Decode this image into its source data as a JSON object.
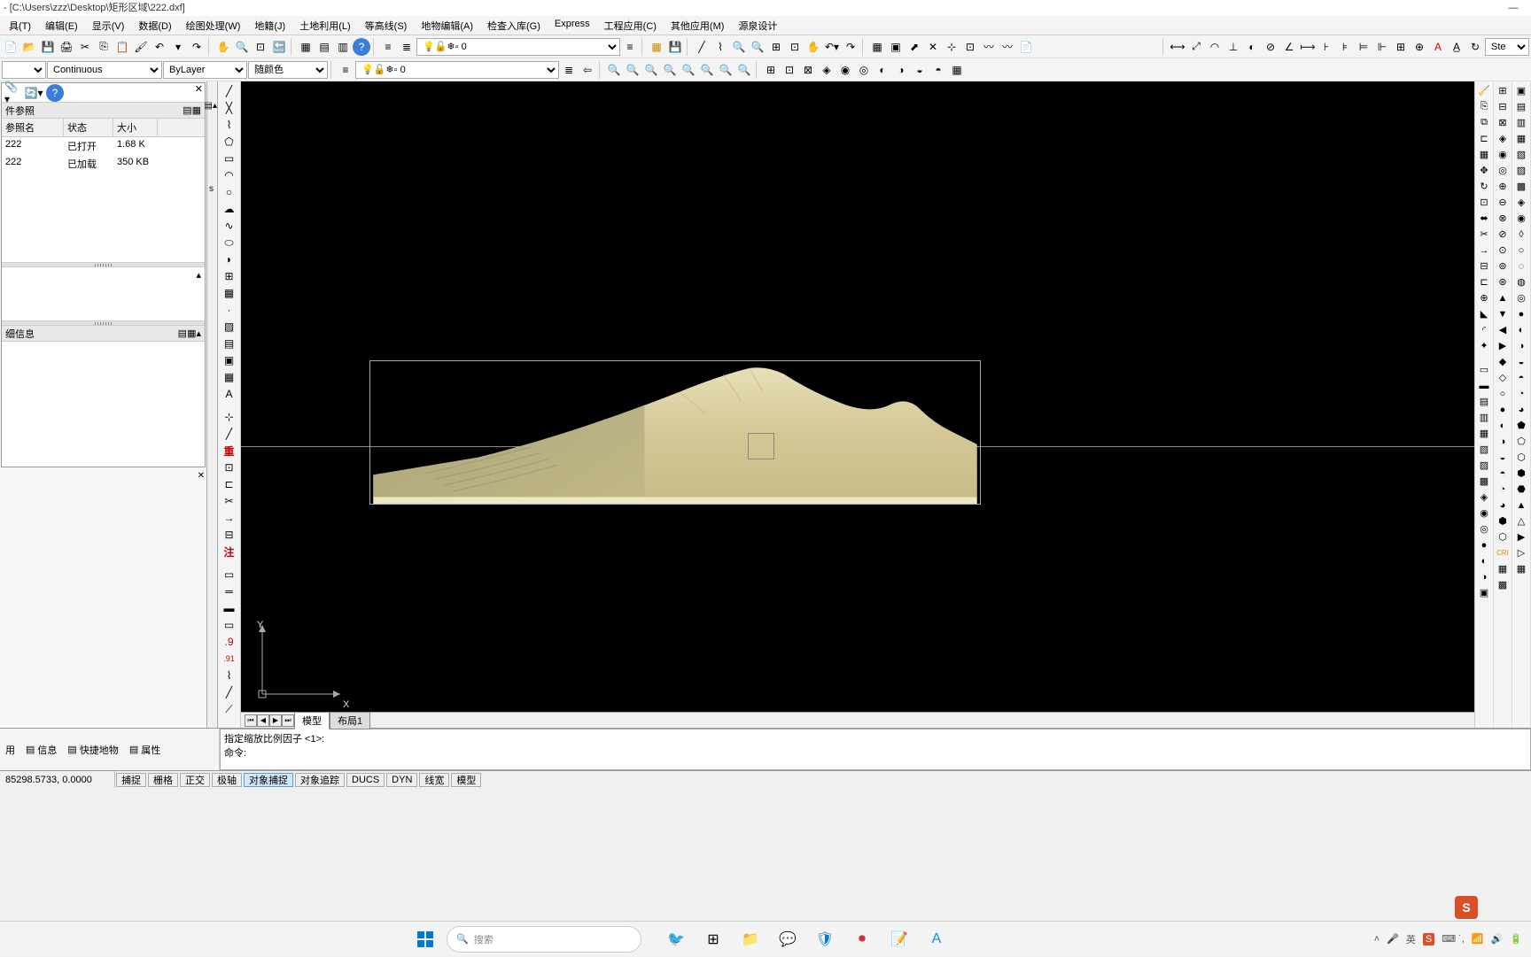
{
  "title": "- [C:\\Users\\zzz\\Desktop\\矩形区域\\222.dxf]",
  "menus": [
    "具(T)",
    "编辑(E)",
    "显示(V)",
    "数据(D)",
    "绘图处理(W)",
    "地籍(J)",
    "土地利用(L)",
    "等高线(S)",
    "地物编辑(A)",
    "检查入库(G)",
    "Express",
    "工程应用(C)",
    "其他应用(M)",
    "源泉设计"
  ],
  "toolbar2": {
    "linetype": "Continuous",
    "lineweight": "ByLayer",
    "colorlabel": "随颜色",
    "layer": "0"
  },
  "layer_combo": "0",
  "ref_panel": {
    "title": "件参照",
    "cols": {
      "name": "参照名",
      "status": "状态",
      "size": "大小"
    },
    "rows": [
      {
        "name": "222",
        "status": "已打开",
        "size": "1.68 K"
      },
      {
        "name": "222",
        "status": "已加载",
        "size": "350 KB"
      }
    ],
    "detail_title": "细信息"
  },
  "layout_tabs": {
    "model": "模型",
    "layout1": "布局1"
  },
  "cmd": {
    "history": "指定缩放比例因子 <1>:",
    "prompt": "命令:"
  },
  "bottom_tabs": [
    "用",
    "信息",
    "快捷地物",
    "属性"
  ],
  "status": {
    "coords": "85298.5733, 0.0000",
    "toggles": [
      "捕捉",
      "栅格",
      "正交",
      "极轴",
      "对象捕捉",
      "对象追踪",
      "DUCS",
      "DYN",
      "线宽",
      "模型"
    ]
  },
  "taskbar": {
    "search_placeholder": "搜索",
    "ime": "S",
    "tray_lang": "英"
  },
  "right_label": "Ste",
  "axes": {
    "x": "X",
    "y": "Y"
  },
  "draw_annot": "注",
  "draw_heavy": "重",
  "draw_num": ".91"
}
